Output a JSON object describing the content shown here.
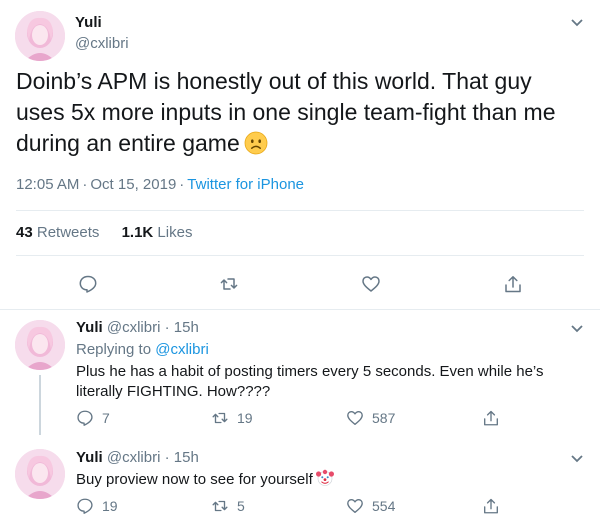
{
  "colors": {
    "text": "#14171a",
    "secondary": "#657786",
    "link": "#1b95e0",
    "divider": "#e6ecf0"
  },
  "main_tweet": {
    "name": "Yuli",
    "handle": "@cxlibri",
    "text": "Doinb’s APM is honestly out of this world. That guy uses 5x more inputs in one single team-fight than me during an entire game",
    "emoji": "worried-face",
    "time": "12:05 AM",
    "separator": "·",
    "date": "Oct 15, 2019",
    "source": "Twitter for iPhone",
    "retweets_count": "43",
    "retweets_label": "Retweets",
    "likes_count": "1.1K",
    "likes_label": "Likes",
    "actions": [
      "reply-icon",
      "retweet-icon",
      "like-icon",
      "share-icon"
    ]
  },
  "replies": [
    {
      "name": "Yuli",
      "handle": "@cxlibri",
      "time": "· 15h",
      "replying_prefix": "Replying to",
      "replying_to": "@cxlibri",
      "text": "Plus he has a habit of posting timers  every 5 seconds. Even while he’s literally FIGHTING. How????",
      "reply_count": "7",
      "retweet_count": "19",
      "like_count": "587"
    },
    {
      "name": "Yuli",
      "handle": "@cxlibri",
      "time": "· 15h",
      "text": "Buy proview now to see for yourself",
      "emoji": "clown-face",
      "reply_count": "19",
      "retweet_count": "5",
      "like_count": "554"
    }
  ]
}
